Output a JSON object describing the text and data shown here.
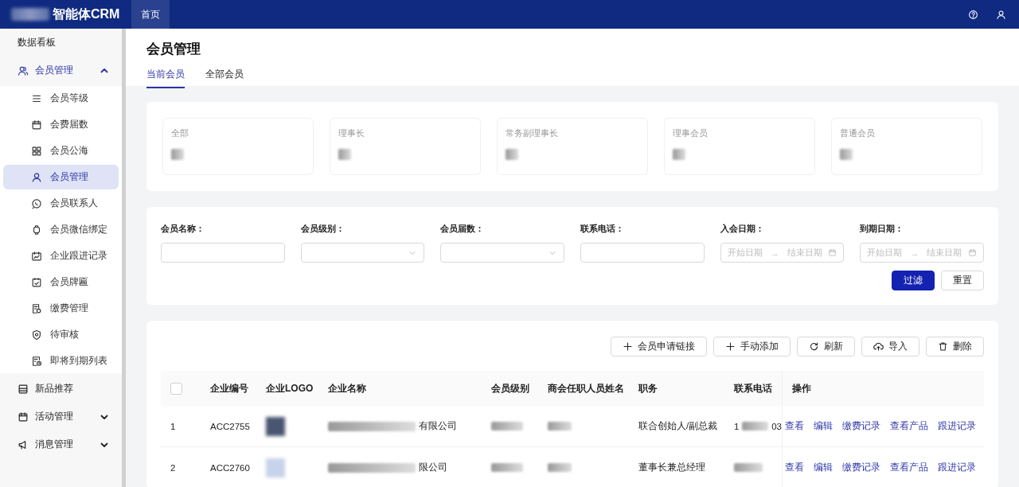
{
  "header": {
    "logo_text": "智能体CRM",
    "tabs": [
      {
        "label": "首页",
        "selected": true
      }
    ]
  },
  "sidebar": {
    "items": [
      {
        "label": "数据看板",
        "kind": "link",
        "selected": false
      },
      {
        "label": "会员管理",
        "kind": "group",
        "expanded": true,
        "selected": true,
        "children": [
          {
            "label": "会员等级",
            "selected": false
          },
          {
            "label": "会费届数",
            "selected": false
          },
          {
            "label": "会员公海",
            "selected": false
          },
          {
            "label": "会员管理",
            "selected": true
          },
          {
            "label": "会员联系人",
            "selected": false
          },
          {
            "label": "会员微信绑定",
            "selected": false
          },
          {
            "label": "企业跟进记录",
            "selected": false
          },
          {
            "label": "会员牌匾",
            "selected": false
          },
          {
            "label": "缴费管理",
            "selected": false
          },
          {
            "label": "待审核",
            "selected": false
          },
          {
            "label": "即将到期列表",
            "selected": false
          }
        ]
      },
      {
        "label": "新品推荐",
        "kind": "link",
        "selected": false
      },
      {
        "label": "活动管理",
        "kind": "group",
        "expanded": false,
        "selected": false
      },
      {
        "label": "消息管理",
        "kind": "group",
        "expanded": false,
        "selected": false
      }
    ]
  },
  "page": {
    "title": "会员管理",
    "tabs": [
      {
        "label": "当前会员",
        "selected": true
      },
      {
        "label": "全部会员",
        "selected": false
      }
    ]
  },
  "stats": [
    {
      "label": "全部"
    },
    {
      "label": "理事长"
    },
    {
      "label": "常务副理事长"
    },
    {
      "label": "理事会员"
    },
    {
      "label": "普通会员"
    }
  ],
  "filters": [
    {
      "label": "会员名称：",
      "kind": "text"
    },
    {
      "label": "会员级别：",
      "kind": "select"
    },
    {
      "label": "会员届数：",
      "kind": "select"
    },
    {
      "label": "联系电话：",
      "kind": "text"
    },
    {
      "label": "入会日期：",
      "kind": "daterange",
      "start_placeholder": "开始日期",
      "separator": "→",
      "end_placeholder": "结束日期"
    },
    {
      "label": "到期日期：",
      "kind": "daterange",
      "start_placeholder": "开始日期",
      "separator": "→",
      "end_placeholder": "结束日期"
    }
  ],
  "filter_buttons": [
    {
      "label": "过滤",
      "kind": "primary"
    },
    {
      "label": "重置",
      "kind": "default"
    }
  ],
  "toolbar": [
    {
      "label": "会员申请链接"
    },
    {
      "label": "手动添加"
    },
    {
      "label": "刷新"
    },
    {
      "label": "导入"
    },
    {
      "label": "删除"
    }
  ],
  "table": {
    "select_all_checked": false,
    "columns": [
      "企业编号",
      "企业LOGO",
      "企业名称",
      "会员级别",
      "商会任职人员姓名",
      "职务",
      "联系电话",
      "操作"
    ],
    "rows": [
      {
        "index": "1",
        "code": "ACC2755",
        "name": "有限公司",
        "position": "联合创始人/副总裁",
        "phone": "1",
        "phone_end": "03",
        "actions": [
          "查看",
          "编辑",
          "缴费记录",
          "查看产品",
          "跟进记录"
        ]
      },
      {
        "index": "2",
        "code": "ACC2760",
        "name": "限公司",
        "position": "董事长兼总经理",
        "phone": "",
        "phone_end": "",
        "actions": [
          "查看",
          "编辑",
          "缴费记录",
          "查看产品",
          "跟进记录"
        ]
      }
    ]
  }
}
